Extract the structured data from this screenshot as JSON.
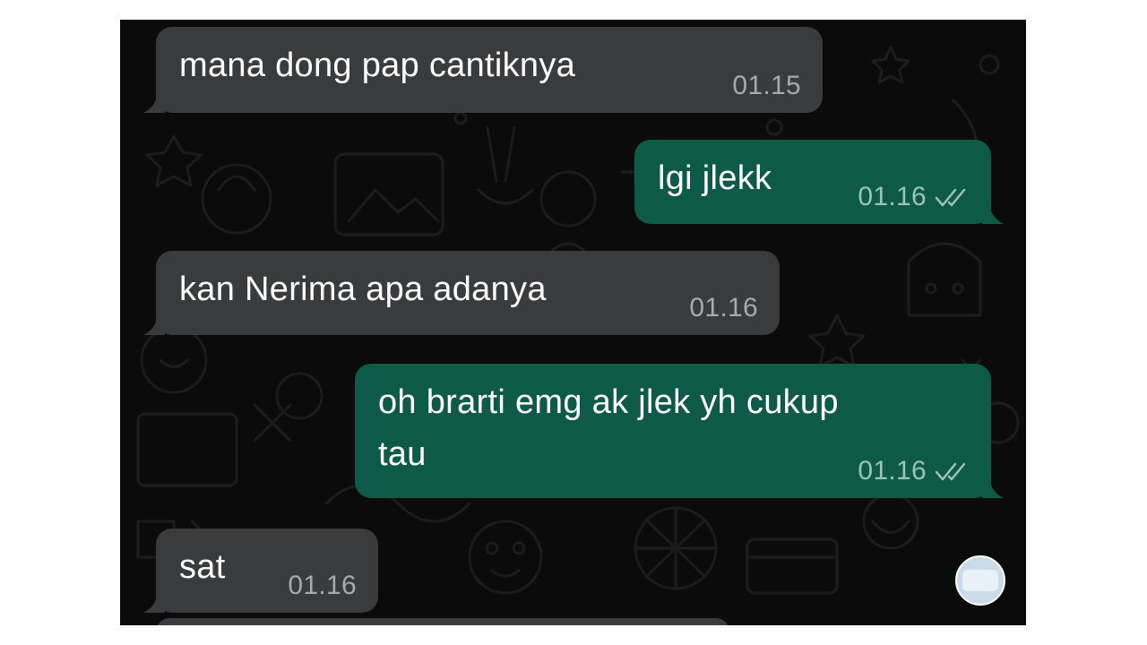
{
  "messages": [
    {
      "direction": "incoming",
      "text": "mana dong pap cantiknya",
      "time": "01.15"
    },
    {
      "direction": "outgoing",
      "text": "lgi jlekk",
      "time": "01.16",
      "status": "read"
    },
    {
      "direction": "incoming",
      "text": "kan Nerima apa adanya",
      "time": "01.16"
    },
    {
      "direction": "outgoing",
      "text": "oh brarti emg ak jlek yh cukup\ntau",
      "time": "01.16",
      "status": "read"
    },
    {
      "direction": "incoming",
      "text": "sat",
      "time": "01.16"
    }
  ],
  "colors": {
    "chat_background": "#0b0b0b",
    "incoming_bubble": "#3a3b3d",
    "outgoing_bubble": "#0d5a48",
    "timestamp_incoming": "#a7a9ab",
    "timestamp_outgoing": "#9cc3b8"
  },
  "icons": {
    "read_receipt": "double-check-icon",
    "scroll_badge": "scroll-to-bottom-icon"
  }
}
